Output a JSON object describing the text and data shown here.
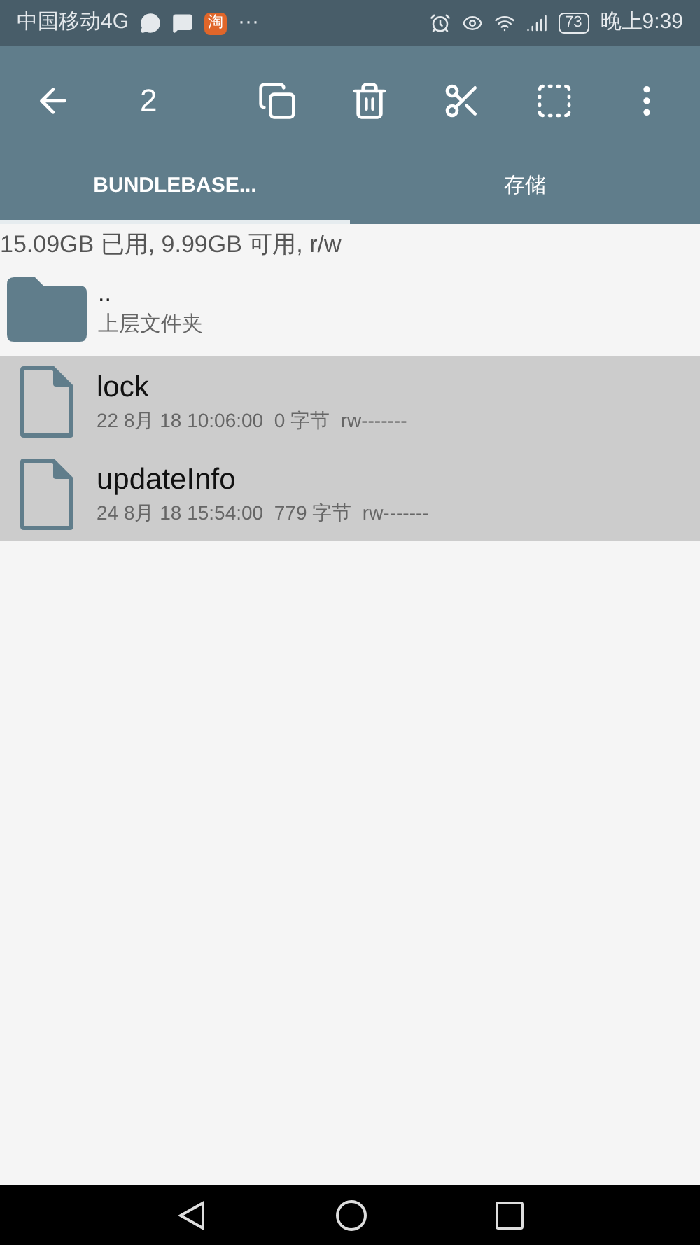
{
  "status_bar": {
    "carrier": "中国移动4G",
    "app_badge": "淘",
    "more": "···",
    "battery": "73",
    "time": "晚上9:39"
  },
  "toolbar": {
    "count": "2"
  },
  "tabs": [
    {
      "label": "BUNDLEBASE...",
      "selected": true
    },
    {
      "label": "存储",
      "selected": false
    }
  ],
  "storage_info": "15.09GB 已用, 9.99GB 可用, r/w",
  "parent": {
    "name": "..",
    "subtitle": "上层文件夹"
  },
  "files": [
    {
      "name": "lock",
      "details": "22 8月 18 10:06:00  0 字节  rw-------",
      "selected": true
    },
    {
      "name": "updateInfo",
      "details": "24 8月 18 15:54:00  779 字节  rw-------",
      "selected": true
    }
  ]
}
